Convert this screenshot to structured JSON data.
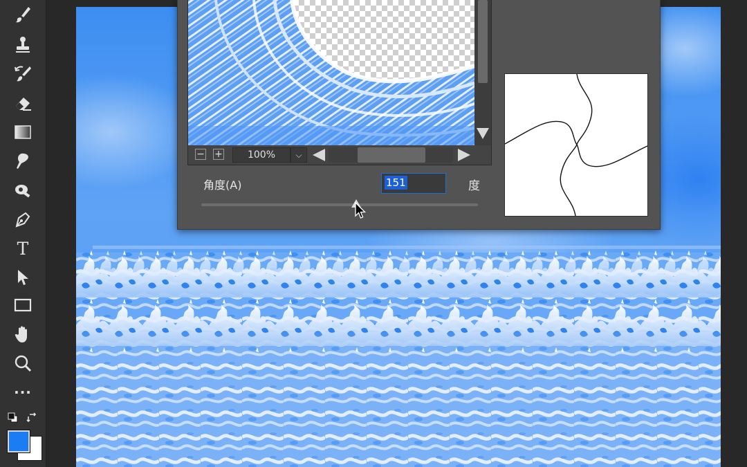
{
  "toolbar": {
    "tools": [
      {
        "name": "brush-icon"
      },
      {
        "name": "stamp-icon"
      },
      {
        "name": "history-brush-icon"
      },
      {
        "name": "eraser-icon"
      },
      {
        "name": "gradient-icon"
      },
      {
        "name": "smudge-icon"
      },
      {
        "name": "dodge-icon"
      },
      {
        "name": "pen-icon"
      },
      {
        "name": "type-icon",
        "glyph": "T"
      },
      {
        "name": "path-select-icon"
      },
      {
        "name": "rectangle-icon"
      },
      {
        "name": "hand-icon"
      },
      {
        "name": "zoom-icon"
      },
      {
        "name": "more-tools-icon",
        "glyph": "···"
      }
    ],
    "foreground_color": "#1b7cf3",
    "background_color": "#ffffff"
  },
  "dialog": {
    "preview": {
      "zoom_out_label": "−",
      "zoom_in_label": "+",
      "zoom_level": "100%",
      "dropdown_glyph": "⌵"
    },
    "angle": {
      "label": "角度(A)",
      "value": "151",
      "unit": "度",
      "slider_fraction": 0.56
    }
  },
  "colors": {
    "canvas_blue": "#3d8ef2",
    "dialog_bg": "#535353",
    "selection": "#1d5fd6"
  }
}
